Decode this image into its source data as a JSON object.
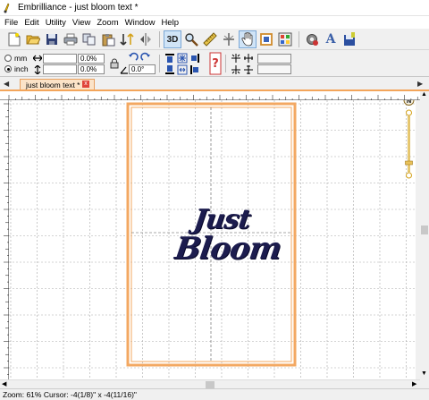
{
  "window": {
    "title": "Embrilliance - just bloom text *"
  },
  "menu": [
    "File",
    "Edit",
    "Utility",
    "View",
    "Zoom",
    "Window",
    "Help"
  ],
  "toolbar": {
    "buttons": [
      "new-file-icon",
      "open-folder-icon",
      "save-icon",
      "print-icon",
      "copy-icon",
      "paste-icon",
      "stitch-order-icon",
      "mirror-icon",
      "3d-view-button",
      "magnify-icon",
      "ruler-icon",
      "needle-icon",
      "select-hand-icon",
      "hoop-icon",
      "color-chart-icon",
      "settings-icon",
      "text-tool-icon",
      "save-disk-icon"
    ],
    "view_3d_label": "3D",
    "text_tool_label": "A"
  },
  "units": {
    "mm_label": "mm",
    "inch_label": "inch",
    "selected": "inch"
  },
  "size_fields": {
    "width_value": "",
    "width_pct": "0.0%",
    "height_value": "",
    "height_pct": "0.0%",
    "rotate_value": "0.0°"
  },
  "tab": {
    "label": "just bloom text *",
    "close_label": "x"
  },
  "design": {
    "line1": "Just",
    "line2": "Bloom",
    "thread_color": "#1c1c4e"
  },
  "hoop": {
    "border_color": "#f3a862"
  },
  "status": {
    "text": "Zoom: 61%  Cursor: -4(1/8)\" x -4(11/16)\""
  }
}
